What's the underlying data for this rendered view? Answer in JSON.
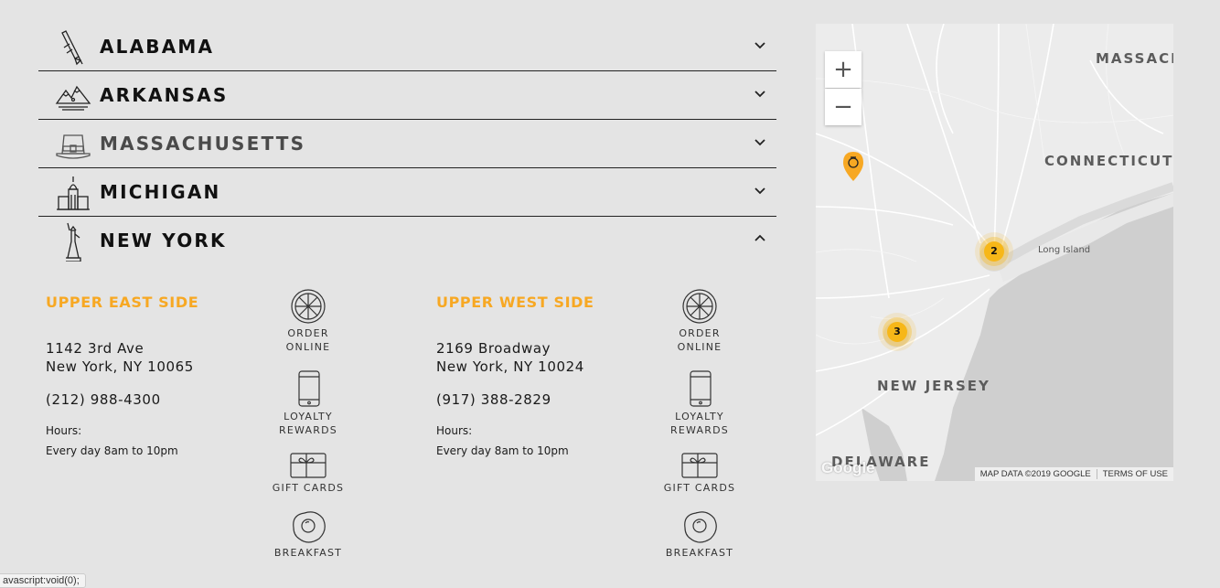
{
  "states": [
    {
      "label": "ALABAMA",
      "icon": "rocket-icon",
      "expanded": false
    },
    {
      "label": "ARKANSAS",
      "icon": "mountains-icon",
      "expanded": false
    },
    {
      "label": "MASSACHUSETTS",
      "icon": "pilgrim-hat-icon",
      "expanded": false
    },
    {
      "label": "MICHIGAN",
      "icon": "capitol-building-icon",
      "expanded": false
    },
    {
      "label": "NEW YORK",
      "icon": "statue-of-liberty-icon",
      "expanded": true
    }
  ],
  "locations": [
    {
      "name": "UPPER EAST SIDE",
      "address_line1": "1142 3rd Ave",
      "address_line2": "New York, NY 10065",
      "phone": "(212) 988-4300",
      "hours_label": "Hours:",
      "hours": "Every day 8am to 10pm"
    },
    {
      "name": "UPPER WEST SIDE",
      "address_line1": "2169 Broadway",
      "address_line2": "New York, NY 10024",
      "phone": "(917) 388-2829",
      "hours_label": "Hours:",
      "hours": "Every day 8am to 10pm"
    }
  ],
  "services": {
    "order_line1": "ORDER",
    "order_line2": "ONLINE",
    "loyalty_line1": "LOYALTY",
    "loyalty_line2": "REWARDS",
    "gift": "GIFT CARDS",
    "breakfast": "BREAKFAST"
  },
  "map": {
    "zoom_in": "+",
    "zoom_out": "−",
    "labels": {
      "massachusetts": "MASSACH",
      "connecticut": "CONNECTICUT",
      "long_island": "Long Island",
      "new_jersey": "NEW JERSEY",
      "delaware": "DELAWARE"
    },
    "clusters": [
      {
        "count": "2"
      },
      {
        "count": "3"
      }
    ],
    "attribution_data": "MAP DATA ©2019 GOOGLE",
    "attribution_terms": "TERMS OF USE",
    "google_logo": "Google",
    "accent_color": "#f7a823"
  },
  "status_bar": "avascript:void(0);"
}
